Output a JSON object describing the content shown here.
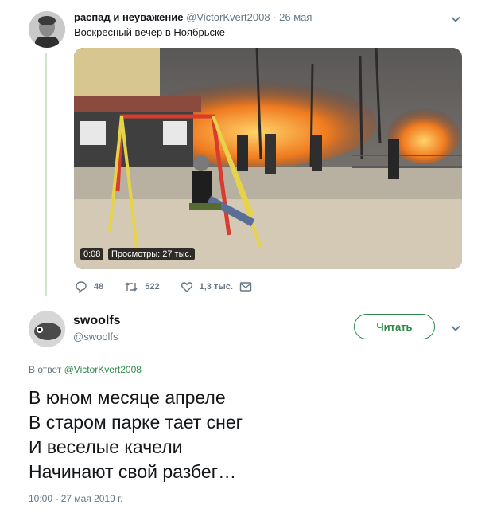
{
  "tweet1": {
    "author_name": "распад и неуважение",
    "author_handle": "@VictorKvert2008",
    "date": "· 26 мая",
    "text": "Воскресный вечер в Ноябрьске",
    "video": {
      "duration": "0:08",
      "views": "Просмотры: 27 тыс."
    },
    "actions": {
      "replies": "48",
      "retweets": "522",
      "likes": "1,3 тыс."
    }
  },
  "tweet2": {
    "author_name": "swoolfs",
    "author_handle": "@swoolfs",
    "follow_label": "Читать",
    "reply_prefix": "В ответ",
    "reply_to": "@VictorKvert2008",
    "poem_lines": [
      "В юном месяце апреле",
      "В старом парке тает снег",
      "И веселые качели",
      "Начинают свой разбег…"
    ],
    "timestamp": "10:00 - 27 мая 2019 г."
  },
  "colors": {
    "accent": "#2b8a4a",
    "secondary_text": "#657786",
    "thread_line": "#cde6c8"
  }
}
